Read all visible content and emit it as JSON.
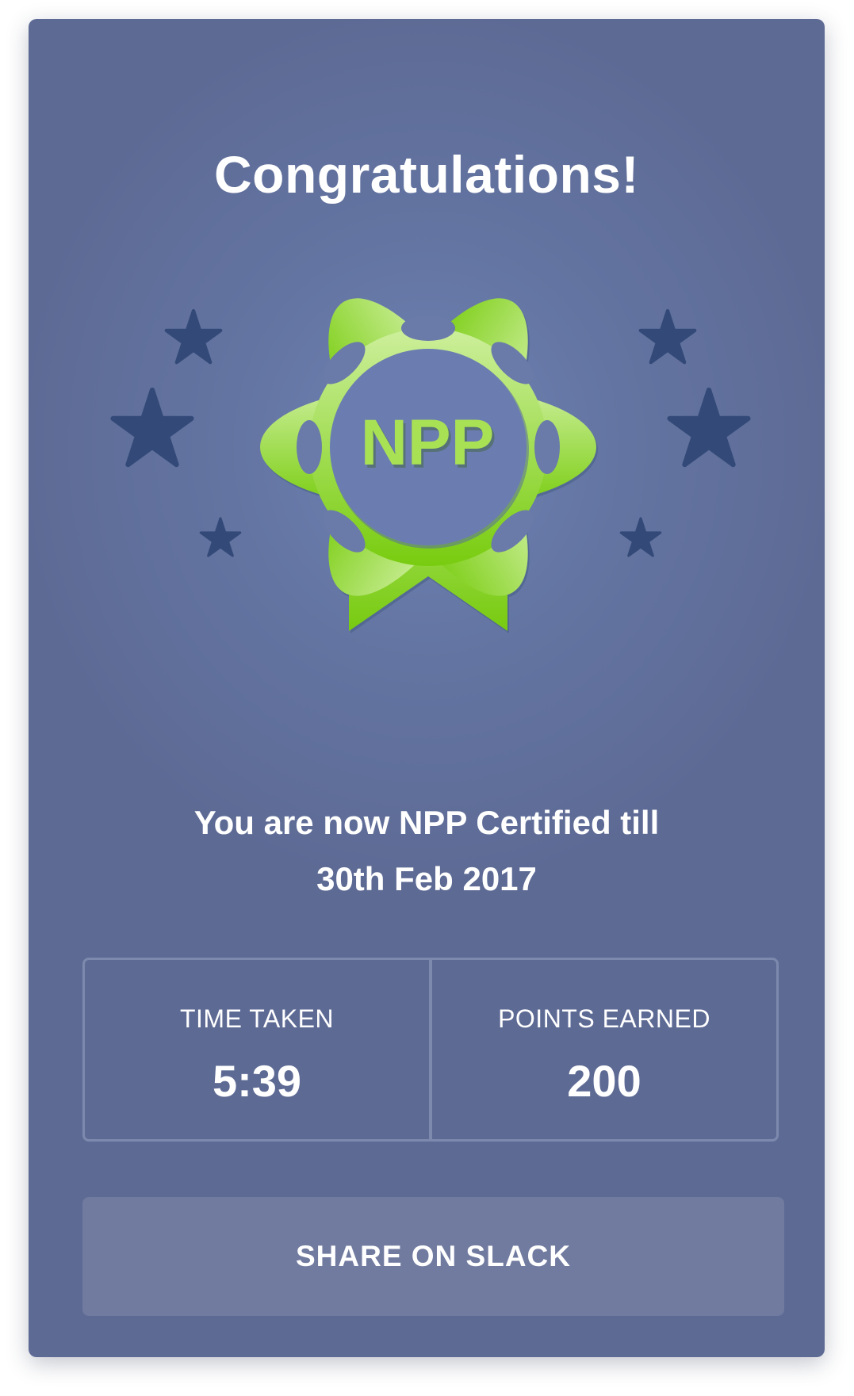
{
  "title": "Congratulations!",
  "badge": {
    "text": "NPP",
    "icon": "award-ribbon-icon",
    "star_icon": "star-icon"
  },
  "message": {
    "line1": "You are now NPP Certified till",
    "line2": "30th Feb 2017"
  },
  "stats": [
    {
      "label": "TIME TAKEN",
      "value": "5:39"
    },
    {
      "label": "POINTS EARNED",
      "value": "200"
    }
  ],
  "share_button": {
    "label": "SHARE ON SLACK"
  },
  "colors": {
    "card_background": "#5d6a94",
    "badge_green_top": "#c9ee95",
    "badge_green_bottom": "#78cc0f",
    "star": "#334a78"
  }
}
